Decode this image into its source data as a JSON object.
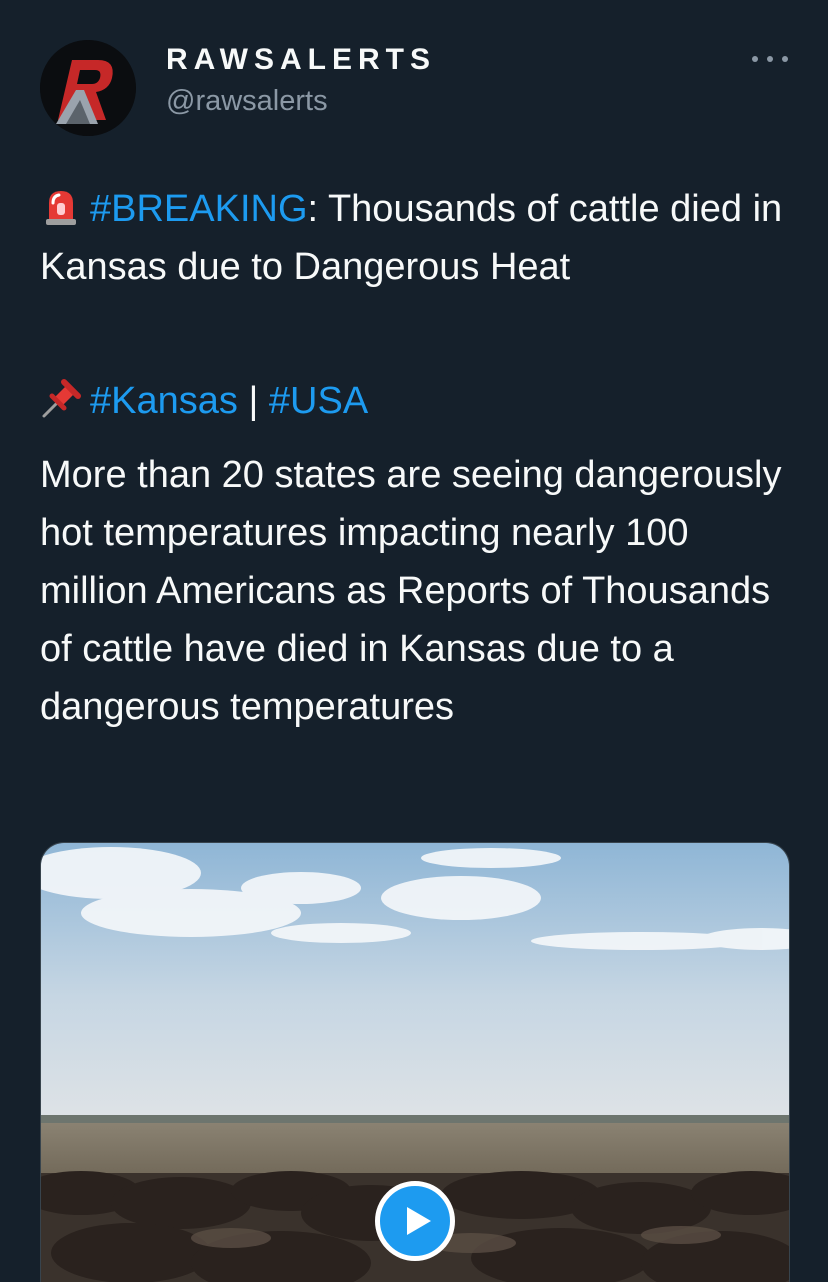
{
  "author": {
    "display_name": "RAWSALERTS",
    "handle": "@rawsalerts",
    "avatar_icon": "rawsalerts-logo"
  },
  "menu": {
    "icon": "more-horizontal-icon"
  },
  "tweet": {
    "p1": {
      "emoji": "rotating-light",
      "hashtag": "#BREAKING",
      "text": ": Thousands of cattle died in Kansas due to Dangerous Heat"
    },
    "p2": {
      "emoji": "pushpin",
      "hashtag1": "#Kansas",
      "separator": " | ",
      "hashtag2": "#USA"
    },
    "p3": {
      "text": "More than 20 states are seeing dangerously hot temperatures impacting nearly 100 million Americans as Reports of Thousands of cattle have died in Kansas due to a dangerous temperatures"
    }
  },
  "media": {
    "type": "video",
    "play_icon": "play-icon"
  },
  "colors": {
    "background": "#15202b",
    "text": "#f7f9f9",
    "secondary_text": "#8b98a5",
    "link": "#1d9bf0"
  }
}
